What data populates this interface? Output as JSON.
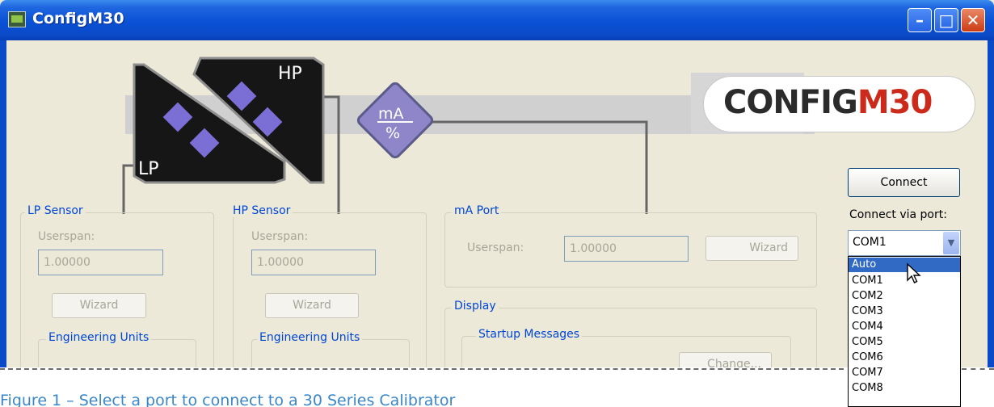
{
  "window": {
    "title": "ConfigM30",
    "controls": {
      "minimize": "–",
      "maximize": "□",
      "close": "✕"
    }
  },
  "logo": {
    "prefix": "CONFIG",
    "suffix": "M30"
  },
  "graphic": {
    "lp_label": "LP",
    "hp_label": "HP",
    "ma_top": "mA",
    "ma_bottom": "%"
  },
  "lp_sensor": {
    "title": "LP Sensor",
    "userspan_label": "Userspan:",
    "userspan_value": "1.00000",
    "wizard_label": "Wizard",
    "eng_units_title": "Engineering Units"
  },
  "hp_sensor": {
    "title": "HP Sensor",
    "userspan_label": "Userspan:",
    "userspan_value": "1.00000",
    "wizard_label": "Wizard",
    "eng_units_title": "Engineering Units"
  },
  "ma_port": {
    "title": "mA Port",
    "userspan_label": "Userspan:",
    "userspan_value": "1.00000",
    "wizard_label": "Wizard"
  },
  "display": {
    "title": "Display",
    "startup_title": "Startup Messages",
    "change_label": "Change..."
  },
  "connection": {
    "connect_label": "Connect",
    "port_label": "Connect via port:",
    "selected_port": "COM1",
    "options": [
      "Auto",
      "COM1",
      "COM2",
      "COM3",
      "COM4",
      "COM5",
      "COM6",
      "COM7",
      "COM8"
    ],
    "highlighted": "Auto"
  },
  "caption": "Figure 1 – Select a port to connect to a 30 Series Calibrator"
}
